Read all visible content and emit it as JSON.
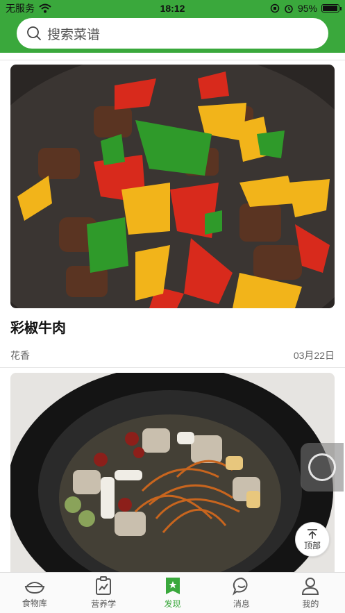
{
  "status_bar": {
    "carrier": "无服务",
    "time": "18:12",
    "battery": "95%",
    "battery_level": 0.95
  },
  "search": {
    "placeholder": "搜索菜谱",
    "icon": "search-icon"
  },
  "feed": {
    "cards": [
      {
        "title": "彩椒牛肉",
        "author": "花香",
        "date": "03月22日"
      }
    ]
  },
  "scroll_top": {
    "label": "顶部",
    "icon": "arrow-up-icon"
  },
  "tabbar": {
    "tabs": [
      {
        "label": "食物库",
        "icon": "bowl-icon"
      },
      {
        "label": "营养学",
        "icon": "chart-clipboard-icon"
      },
      {
        "label": "发现",
        "icon": "discover-icon"
      },
      {
        "label": "消息",
        "icon": "message-icon"
      },
      {
        "label": "我的",
        "icon": "person-icon"
      }
    ],
    "active_index": 2
  },
  "colors": {
    "brand": "#3aa83c",
    "text": "#111111",
    "muted": "#666666"
  }
}
